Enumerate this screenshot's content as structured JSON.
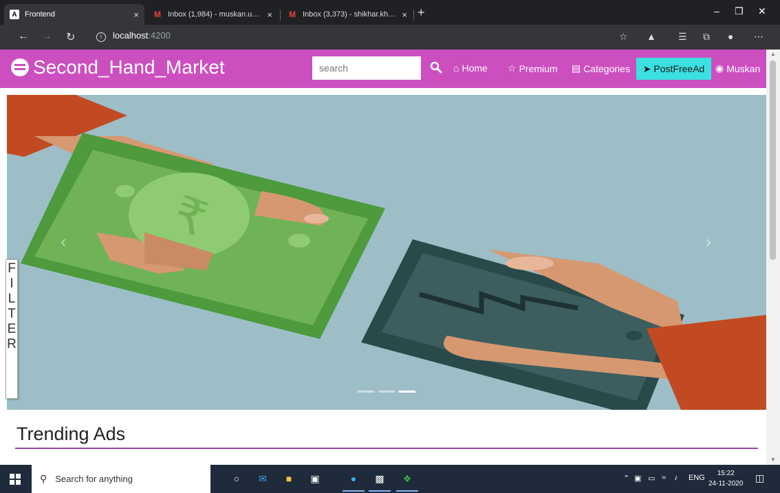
{
  "browser": {
    "tabs": [
      {
        "title": "Frontend",
        "favicon": "A",
        "active": true
      },
      {
        "title": "Inbox (1,984) - muskan.upadhya",
        "favicon": "M",
        "active": false
      },
      {
        "title": "Inbox (3,373) - shikhar.khare_cs1",
        "favicon": "M",
        "active": false
      }
    ],
    "close_glyph": "×",
    "new_tab_glyph": "+",
    "url_host": "localhost",
    "url_port": ":4200"
  },
  "navbar": {
    "brand": "Second_Hand_Market",
    "search_placeholder": "search",
    "links": {
      "home": "Home",
      "premium": "Premium",
      "categories": "Categories",
      "post_ad": "PostFreeAd",
      "user": "Muskan"
    },
    "colors": {
      "bar": "#cc4fc0",
      "post_ad_bg": "#3be0e0"
    }
  },
  "carousel": {
    "prev_glyph": "‹",
    "next_glyph": "›",
    "slide_count": 3,
    "active_slide": 3
  },
  "filter": {
    "letters": [
      "F",
      "I",
      "L",
      "T",
      "E",
      "R"
    ]
  },
  "trending": {
    "title": "Trending Ads"
  },
  "taskbar": {
    "search_text": "Search for anything",
    "language": "ENG",
    "time": "15:22",
    "date": "24-11-2020"
  }
}
